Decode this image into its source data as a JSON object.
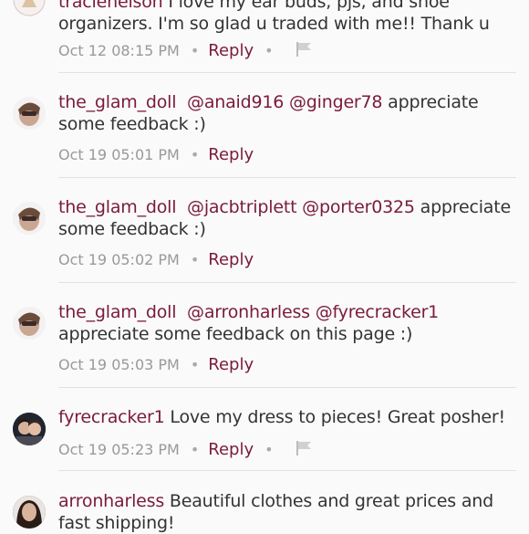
{
  "comments": [
    {
      "user": "tracienelson",
      "text": "I love my ear buds, pjs, and shoe organizers. I'm so glad u traded with me!! Thank u",
      "line1": " I love my ear buds, pjs, and shoe",
      "line2": "organizers. I'm so glad u traded with me!! Thank u",
      "timestamp": "Oct 12 08:15 PM",
      "reply_label": "Reply",
      "has_flag": true
    },
    {
      "user": "the_glam_doll",
      "mentions": [
        "@anaid916",
        "@ginger78"
      ],
      "line1_tail": " appreciate",
      "line2": "some feedback :)",
      "timestamp": "Oct 19 05:01 PM",
      "reply_label": "Reply"
    },
    {
      "user": "the_glam_doll",
      "mentions": [
        "@jacbtriplett",
        "@porter0325"
      ],
      "line1_tail": " appreciate",
      "line2": "some feedback :)",
      "timestamp": "Oct 19 05:02 PM",
      "reply_label": "Reply"
    },
    {
      "user": "the_glam_doll",
      "mentions": [
        "@arronharless",
        "@fyrecracker1"
      ],
      "line2": "appreciate some feedback on this page :)",
      "timestamp": "Oct 19 05:03 PM",
      "reply_label": "Reply"
    },
    {
      "user": "fyrecracker1",
      "text": " Love my dress to pieces!  Great posher!",
      "timestamp": "Oct 19 05:23 PM",
      "reply_label": "Reply",
      "has_flag": true
    },
    {
      "user": "arronharless",
      "line1": " Beautiful clothes and great prices and",
      "line2": "fast shipping!"
    }
  ],
  "colors": {
    "accent": "#7a1b3a",
    "meta": "#999999",
    "divider": "#e2e2e2"
  },
  "icons": {
    "flag": "flag-icon",
    "dot": "bullet-separator"
  }
}
